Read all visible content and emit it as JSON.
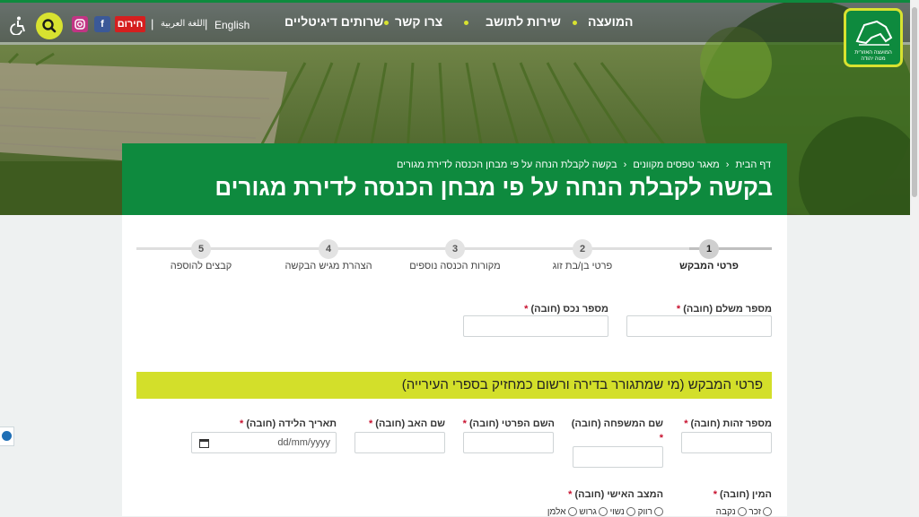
{
  "nav": {
    "items": [
      "המועצה",
      "שירות לתושב",
      "צרו קשר",
      "שרותים דיגיטליים"
    ],
    "lang_english": "English",
    "lang_arabic": "اللغة العربية",
    "emergency": "חירום",
    "social": [
      {
        "icon": "facebook-icon",
        "glyph": "f",
        "color": "#3b5998"
      },
      {
        "icon": "instagram-icon",
        "glyph": "◎",
        "color": "#c13584"
      }
    ],
    "accent_color": "#d8e230"
  },
  "logo": {
    "line1": "המועצה האזורית",
    "line2": "מטה יהודה"
  },
  "breadcrumb": [
    "דף הבית",
    "מאגר טפסים מקוונים",
    "בקשה לקבלת הנחה על פי מבחן הכנסה לדירת מגורים"
  ],
  "page_title": "בקשה לקבלת הנחה על פי מבחן הכנסה לדירת מגורים",
  "steps": [
    {
      "num": "1",
      "label": "פרטי המבקש"
    },
    {
      "num": "2",
      "label": "פרטי בן/בת זוג"
    },
    {
      "num": "3",
      "label": "מקורות הכנסה נוספים"
    },
    {
      "num": "4",
      "label": "הצהרת מגיש הבקשה"
    },
    {
      "num": "5",
      "label": "קבצים להוספה"
    }
  ],
  "fields_top": {
    "payer_number": "מספר משלם (חובה)",
    "property_number": "מספר נכס (חובה)"
  },
  "section_title": "פרטי המבקש (מי שמתגורר בדירה ורשום כמחזיק בספרי העירייה)",
  "fields": {
    "id_number": "מספר זהות (חובה)",
    "last_name": "שם המשפחה (חובה)",
    "first_name": "השם הפרטי (חובה)",
    "father_name": "שם האב (חובה)",
    "birth_date": "תאריך הלידה (חובה)",
    "birth_date_placeholder": "dd/mm/yyyy",
    "gender": "המין (חובה)",
    "marital_status": "המצב האישי (חובה)"
  },
  "required_mark": "*",
  "gender_options": [
    "זכר",
    "נקבה"
  ],
  "marital_options": [
    "רווק",
    "נשוי",
    "גרוש",
    "אלמן"
  ],
  "colors": {
    "primary": "#0e8a3e",
    "section": "#d3df2a",
    "required": "#c8102e"
  }
}
